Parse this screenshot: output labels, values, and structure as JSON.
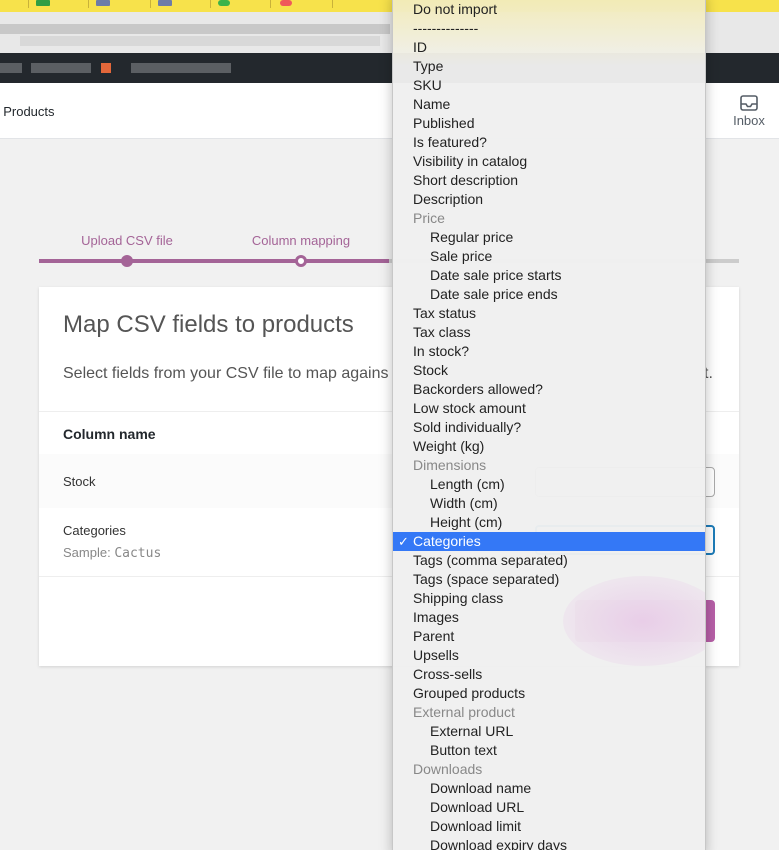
{
  "page": {
    "title_partial": "t Products",
    "inbox_label": "Inbox"
  },
  "steps": [
    {
      "label": "Upload CSV file",
      "state": "done"
    },
    {
      "label": "Column mapping",
      "state": "current"
    }
  ],
  "card": {
    "title": "Map CSV fields to products",
    "description_visible": "Select fields from your CSV file to map agains",
    "description_end": "t.",
    "column_header": "Column name",
    "rows": [
      {
        "name": "Stock",
        "sample_label": "",
        "sample_value": ""
      },
      {
        "name": "Categories",
        "sample_label": "Sample:",
        "sample_value": "Cactus"
      }
    ]
  },
  "dropdown": {
    "selected": "Categories",
    "check_glyph": "✓",
    "options": [
      {
        "label": "Do not import",
        "type": "option"
      },
      {
        "label": "--------------",
        "type": "option"
      },
      {
        "label": "ID",
        "type": "option"
      },
      {
        "label": "Type",
        "type": "option"
      },
      {
        "label": "SKU",
        "type": "option"
      },
      {
        "label": "Name",
        "type": "option"
      },
      {
        "label": "Published",
        "type": "option"
      },
      {
        "label": "Is featured?",
        "type": "option"
      },
      {
        "label": "Visibility in catalog",
        "type": "option"
      },
      {
        "label": "Short description",
        "type": "option"
      },
      {
        "label": "Description",
        "type": "option"
      },
      {
        "label": "Price",
        "type": "group"
      },
      {
        "label": "Regular price",
        "type": "child"
      },
      {
        "label": "Sale price",
        "type": "child"
      },
      {
        "label": "Date sale price starts",
        "type": "child"
      },
      {
        "label": "Date sale price ends",
        "type": "child"
      },
      {
        "label": "Tax status",
        "type": "option"
      },
      {
        "label": "Tax class",
        "type": "option"
      },
      {
        "label": "In stock?",
        "type": "option"
      },
      {
        "label": "Stock",
        "type": "option"
      },
      {
        "label": "Backorders allowed?",
        "type": "option"
      },
      {
        "label": "Low stock amount",
        "type": "option"
      },
      {
        "label": "Sold individually?",
        "type": "option"
      },
      {
        "label": "Weight (kg)",
        "type": "option"
      },
      {
        "label": "Dimensions",
        "type": "group"
      },
      {
        "label": "Length (cm)",
        "type": "child"
      },
      {
        "label": "Width (cm)",
        "type": "child"
      },
      {
        "label": "Height (cm)",
        "type": "child"
      },
      {
        "label": "Categories",
        "type": "option"
      },
      {
        "label": "Tags (comma separated)",
        "type": "option"
      },
      {
        "label": "Tags (space separated)",
        "type": "option"
      },
      {
        "label": "Shipping class",
        "type": "option"
      },
      {
        "label": "Images",
        "type": "option"
      },
      {
        "label": "Parent",
        "type": "option"
      },
      {
        "label": "Upsells",
        "type": "option"
      },
      {
        "label": "Cross-sells",
        "type": "option"
      },
      {
        "label": "Grouped products",
        "type": "option"
      },
      {
        "label": "External product",
        "type": "group"
      },
      {
        "label": "External URL",
        "type": "child"
      },
      {
        "label": "Button text",
        "type": "child"
      },
      {
        "label": "Downloads",
        "type": "group"
      },
      {
        "label": "Download name",
        "type": "child"
      },
      {
        "label": "Download URL",
        "type": "child"
      },
      {
        "label": "Download limit",
        "type": "child"
      },
      {
        "label": "Download expiry days",
        "type": "child"
      }
    ]
  },
  "colors": {
    "accent": "#a46497",
    "selected_option": "#3478f6",
    "focus_border": "#1c7cb9",
    "admin_bar": "#23282d",
    "bookmarks_bar": "#f7e24b"
  }
}
